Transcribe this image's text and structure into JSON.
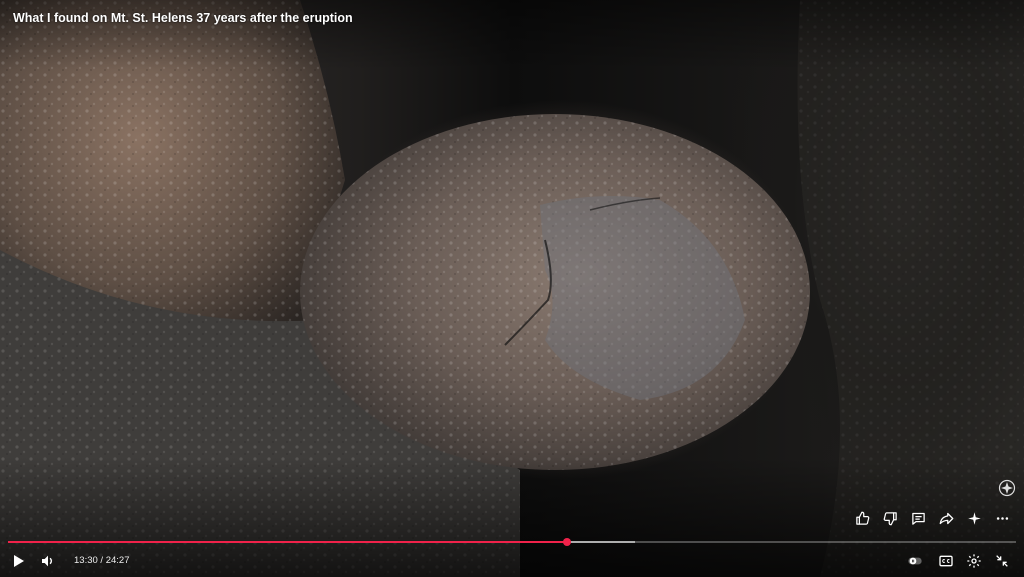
{
  "video": {
    "title": "What I found on Mt. St. Helens 37 years after the eruption"
  },
  "player": {
    "current_time": "13:30",
    "separator": " / ",
    "duration": "24:27",
    "played_fraction": 0.555,
    "buffered_fraction": 0.622,
    "accent_color": "#f0224a"
  },
  "actions": [
    {
      "name": "like-icon"
    },
    {
      "name": "dislike-icon"
    },
    {
      "name": "comment-icon"
    },
    {
      "name": "share-icon"
    },
    {
      "name": "sparkle-icon"
    },
    {
      "name": "more-icon"
    }
  ],
  "controls": {
    "play": "play-icon",
    "volume": "volume-icon",
    "autoplay": "autoplay-toggle-icon",
    "captions": "captions-icon",
    "settings": "gear-icon",
    "fullscreen": "exit-fullscreen-icon"
  }
}
